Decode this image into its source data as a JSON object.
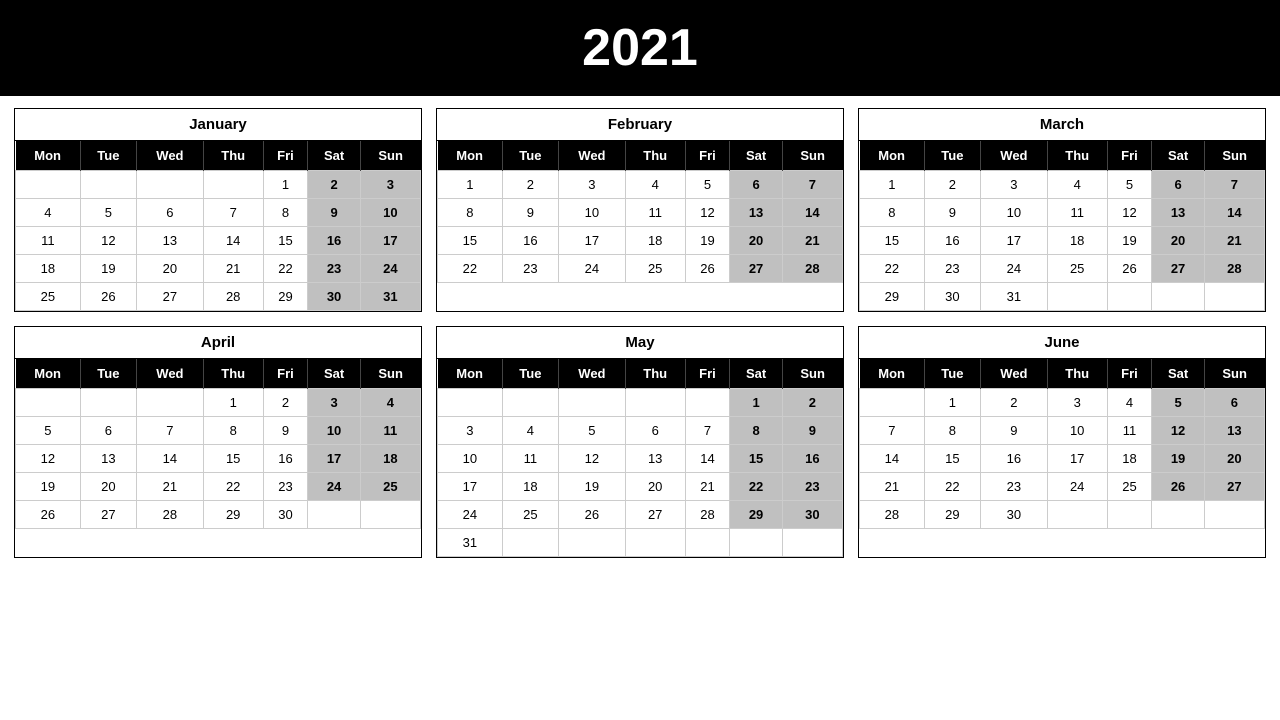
{
  "year": "2021",
  "months": [
    {
      "name": "January",
      "startDay": 4,
      "days": 31
    },
    {
      "name": "February",
      "startDay": 0,
      "days": 28
    },
    {
      "name": "March",
      "startDay": 0,
      "days": 31
    },
    {
      "name": "April",
      "startDay": 3,
      "days": 30
    },
    {
      "name": "May",
      "startDay": 5,
      "days": 31
    },
    {
      "name": "June",
      "startDay": 1,
      "days": 30
    }
  ],
  "dayHeaders": [
    "Mon",
    "Tue",
    "Wed",
    "Thu",
    "Fri",
    "Sat",
    "Sun"
  ]
}
